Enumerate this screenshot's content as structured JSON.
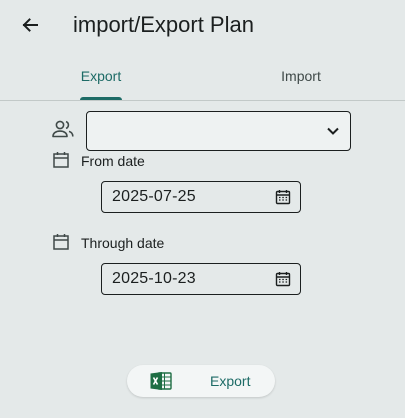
{
  "header": {
    "title": "import/Export Plan",
    "back_icon": "arrow-left-icon"
  },
  "tabs": [
    {
      "label": "Export",
      "selected": true
    },
    {
      "label": "Import",
      "selected": false
    }
  ],
  "form": {
    "user_select": {
      "icon": "people-icon",
      "value": "",
      "chevron_icon": "chevron-down-icon"
    },
    "from_date": {
      "label": "From date",
      "value": "2025-07-25",
      "icon": "calendar-icon"
    },
    "through_date": {
      "label": "Through date",
      "value": "2025-10-23",
      "icon": "calendar-icon"
    }
  },
  "actions": {
    "export_label": "Export",
    "export_icon": "excel-icon"
  },
  "colors": {
    "background": "#e4e9e9",
    "accent": "#1d6b66",
    "excel_green": "#1e6e44"
  }
}
